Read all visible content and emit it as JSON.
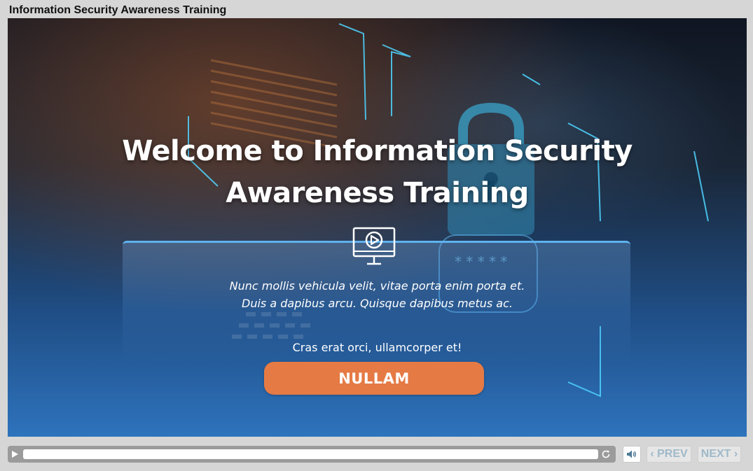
{
  "window": {
    "title": "Information Security Awareness Training"
  },
  "slide": {
    "headline_line1": "Welcome to Information Security",
    "headline_line2": "Awareness Training",
    "intro_line1": "Nunc mollis vehicula velit, vitae porta enim porta et.",
    "intro_line2": "Duis a dapibus arcu. Quisque dapibus metus ac.",
    "cta_prompt": "Cras erat orci, ullamcorper et!",
    "cta_button": "NULLAM",
    "password_mask": "* * * * *"
  },
  "player": {
    "progress": 0,
    "prev_label": "‹ PREV",
    "next_label": "NEXT ›"
  },
  "colors": {
    "accent_orange": "#e57a45",
    "panel_border": "#5fb2ee",
    "nav_text": "#9fb9c9",
    "stage_bottom": "#2e73bd"
  },
  "icons": {
    "play": "play-icon",
    "replay": "replay-icon",
    "audio": "speaker-icon",
    "monitor": "monitor-play-icon",
    "padlock": "padlock-icon"
  }
}
